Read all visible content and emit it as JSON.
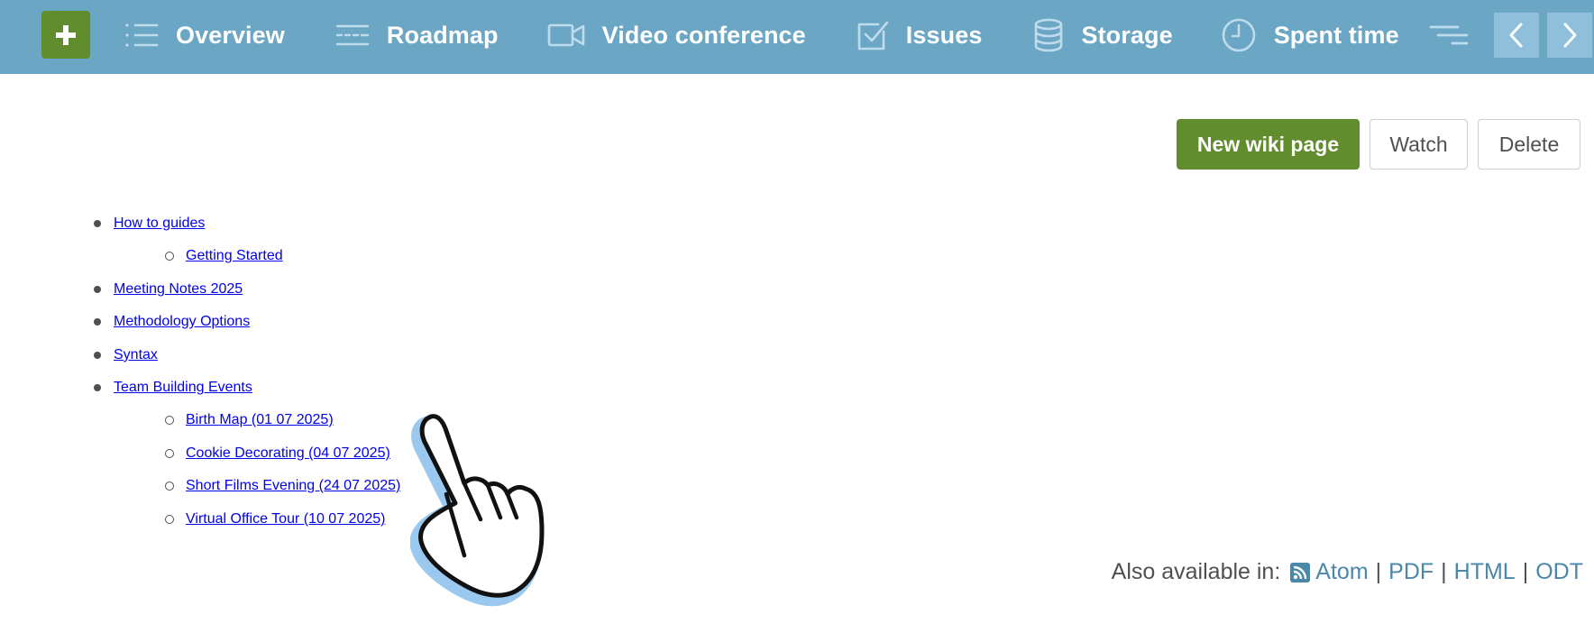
{
  "topbar": {
    "background": "#6ba6c5",
    "plus_button": {
      "icon": "plus-icon",
      "color": "#628d2f"
    },
    "nav_items": [
      {
        "label": "Overview",
        "icon": "list-icon"
      },
      {
        "label": "Roadmap",
        "icon": "roadmap-icon"
      },
      {
        "label": "Video conference",
        "icon": "video-camera-icon"
      },
      {
        "label": "Issues",
        "icon": "checkbox-icon"
      },
      {
        "label": "Storage",
        "icon": "database-icon"
      },
      {
        "label": "Spent time",
        "icon": "clock-icon"
      }
    ],
    "more_icon": "more-menu-icon",
    "scroll_left_icon": "chevron-left-icon",
    "scroll_right_icon": "chevron-right-icon"
  },
  "actions": {
    "new_wiki_page": "New wiki page",
    "watch": "Watch",
    "delete": "Delete"
  },
  "wiki_index": [
    {
      "title": "How to guides",
      "children": [
        {
          "title": "Getting Started"
        }
      ]
    },
    {
      "title": "Meeting Notes 2025",
      "children": []
    },
    {
      "title": "Methodology Options",
      "children": []
    },
    {
      "title": "Syntax",
      "children": []
    },
    {
      "title": "Team Building Events",
      "children": [
        {
          "title": "Birth Map (01 07 2025)"
        },
        {
          "title": "Cookie Decorating (04 07 2025)"
        },
        {
          "title": "Short Films Evening (24 07 2025)"
        },
        {
          "title": "Virtual Office Tour (10 07 2025)"
        }
      ]
    }
  ],
  "footer": {
    "also_available": "Also available in:",
    "formats": [
      "Atom",
      "PDF",
      "HTML",
      "ODT"
    ],
    "atom_icon": "rss-feed-icon"
  },
  "colors": {
    "accent_green": "#628d2f",
    "link": "#4a87a8",
    "text": "#505050"
  }
}
